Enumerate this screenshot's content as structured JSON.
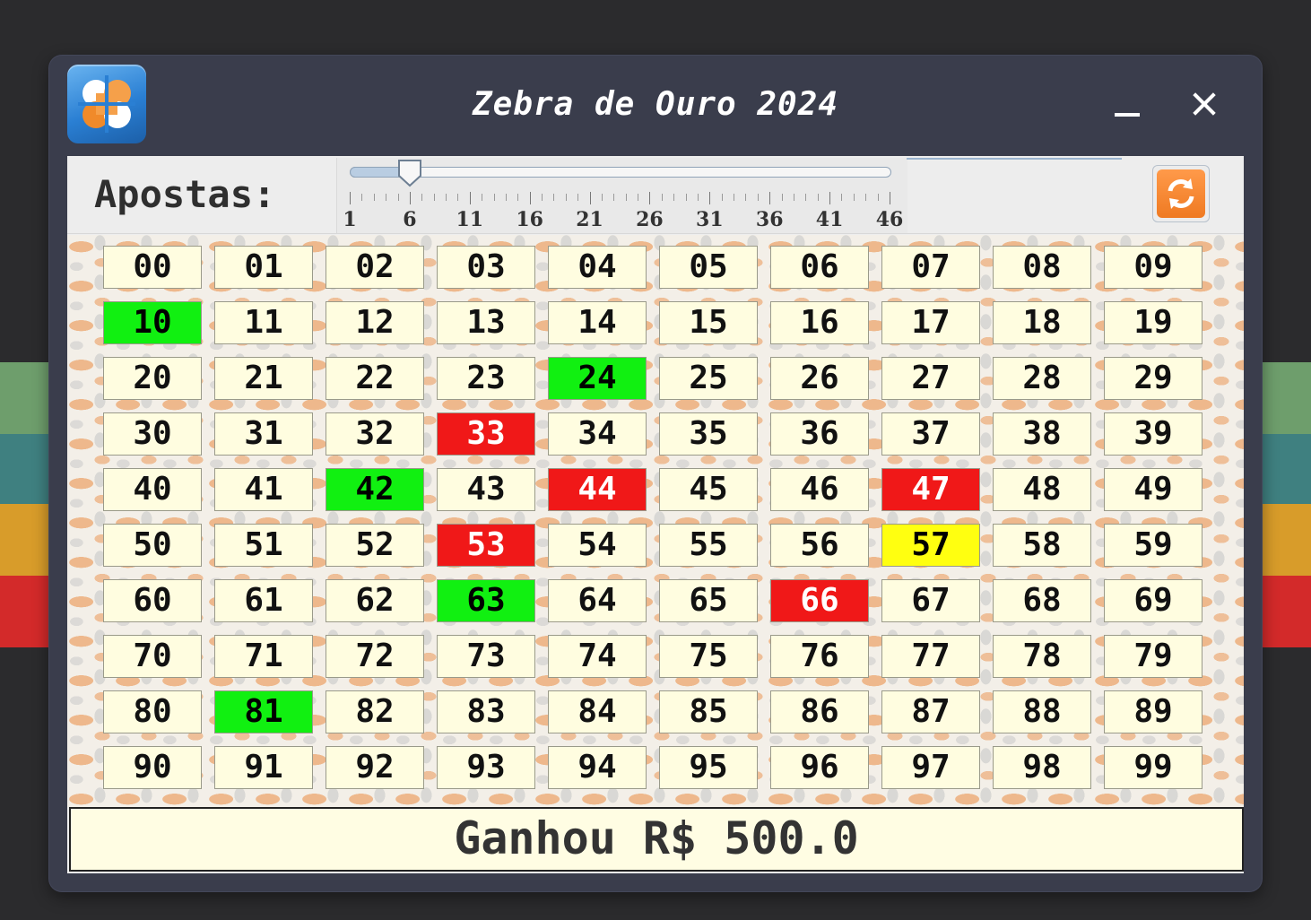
{
  "window": {
    "title": "Zebra de Ouro 2024"
  },
  "toolbar": {
    "apostas_label": "Apostas:",
    "slider": {
      "min": 1,
      "max": 46,
      "value": 6,
      "tick_labels": [
        "1",
        "6",
        "11",
        "16",
        "21",
        "26",
        "31",
        "36",
        "41",
        "46"
      ]
    },
    "refresh_icon": "refresh-icon"
  },
  "colors": {
    "green": "#11f011",
    "red": "#f01818",
    "yellow": "#ffff10",
    "cell": "#fffde0"
  },
  "board": {
    "numbers": [
      "00",
      "01",
      "02",
      "03",
      "04",
      "05",
      "06",
      "07",
      "08",
      "09",
      "10",
      "11",
      "12",
      "13",
      "14",
      "15",
      "16",
      "17",
      "18",
      "19",
      "20",
      "21",
      "22",
      "23",
      "24",
      "25",
      "26",
      "27",
      "28",
      "29",
      "30",
      "31",
      "32",
      "33",
      "34",
      "35",
      "36",
      "37",
      "38",
      "39",
      "40",
      "41",
      "42",
      "43",
      "44",
      "45",
      "46",
      "47",
      "48",
      "49",
      "50",
      "51",
      "52",
      "53",
      "54",
      "55",
      "56",
      "57",
      "58",
      "59",
      "60",
      "61",
      "62",
      "63",
      "64",
      "65",
      "66",
      "67",
      "68",
      "69",
      "70",
      "71",
      "72",
      "73",
      "74",
      "75",
      "76",
      "77",
      "78",
      "79",
      "80",
      "81",
      "82",
      "83",
      "84",
      "85",
      "86",
      "87",
      "88",
      "89",
      "90",
      "91",
      "92",
      "93",
      "94",
      "95",
      "96",
      "97",
      "98",
      "99"
    ],
    "green": [
      "10",
      "24",
      "42",
      "63",
      "81"
    ],
    "red": [
      "33",
      "44",
      "47",
      "53",
      "66"
    ],
    "yellow": [
      "57"
    ]
  },
  "result": {
    "text": "Ganhou R$ 500.0"
  }
}
